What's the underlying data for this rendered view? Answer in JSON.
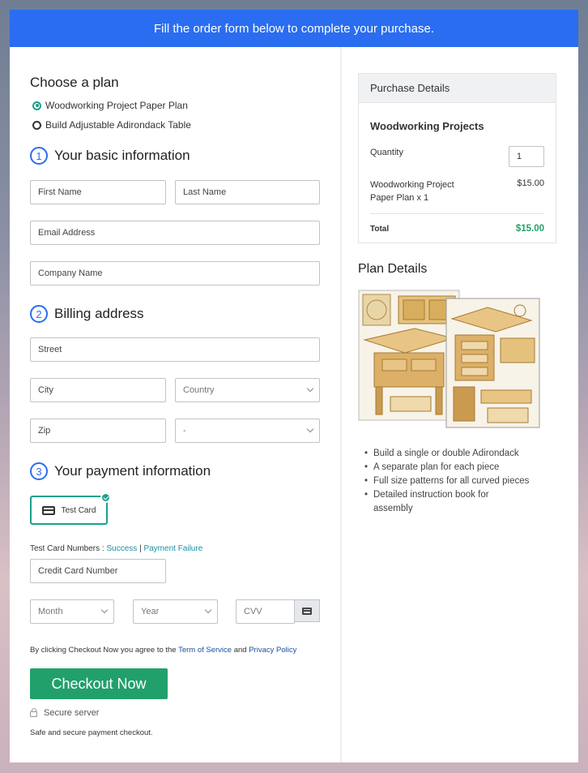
{
  "banner": {
    "text": "Fill the order form below to complete your purchase."
  },
  "plan": {
    "heading": "Choose a plan",
    "options": [
      {
        "label": "Woodworking Project Paper Plan",
        "selected": true
      },
      {
        "label": "Build Adjustable Adirondack Table",
        "selected": false
      }
    ]
  },
  "basic": {
    "number": "1",
    "heading": "Your basic information",
    "first_name": "First Name",
    "last_name": "Last Name",
    "email": "Email Address",
    "company": "Company Name"
  },
  "billing": {
    "number": "2",
    "heading": "Billing address",
    "street": "Street",
    "city": "City",
    "country": "Country",
    "zip": "Zip",
    "state": "-"
  },
  "payment": {
    "number": "3",
    "heading": "Your payment information",
    "test_card_label": "Test Card",
    "test_numbers_prefix": "Test Card Numbers :",
    "success_link": "Success",
    "separator": "|",
    "failure_link": "Payment Failure",
    "card_number": "Credit Card Number",
    "month": "Month",
    "year": "Year",
    "cvv": "CVV"
  },
  "terms": {
    "prefix": "By clicking Checkout Now you agree to the",
    "tos": "Term of Service",
    "and": "and",
    "privacy": "Privacy Policy"
  },
  "checkout": {
    "button": "Checkout Now",
    "secure": "Secure server",
    "note": "Safe and secure payment checkout."
  },
  "purchase": {
    "heading": "Purchase Details",
    "product": "Woodworking Projects",
    "quantity_label": "Quantity",
    "quantity_value": "1",
    "item_line1": "Woodworking Project",
    "item_line2": "Paper Plan x 1",
    "item_price": "$15.00",
    "total_label": "Total",
    "total_value": "$15.00"
  },
  "plan_details": {
    "heading": "Plan Details",
    "bullets": [
      "Build a single or double Adirondack",
      "A separate plan for each piece",
      "Full size patterns for all curved pieces",
      "Detailed instruction book for",
      "assembly"
    ]
  },
  "colors": {
    "accent": "#2a6df0",
    "success": "#22a06b",
    "radio": "#1ba08c"
  }
}
